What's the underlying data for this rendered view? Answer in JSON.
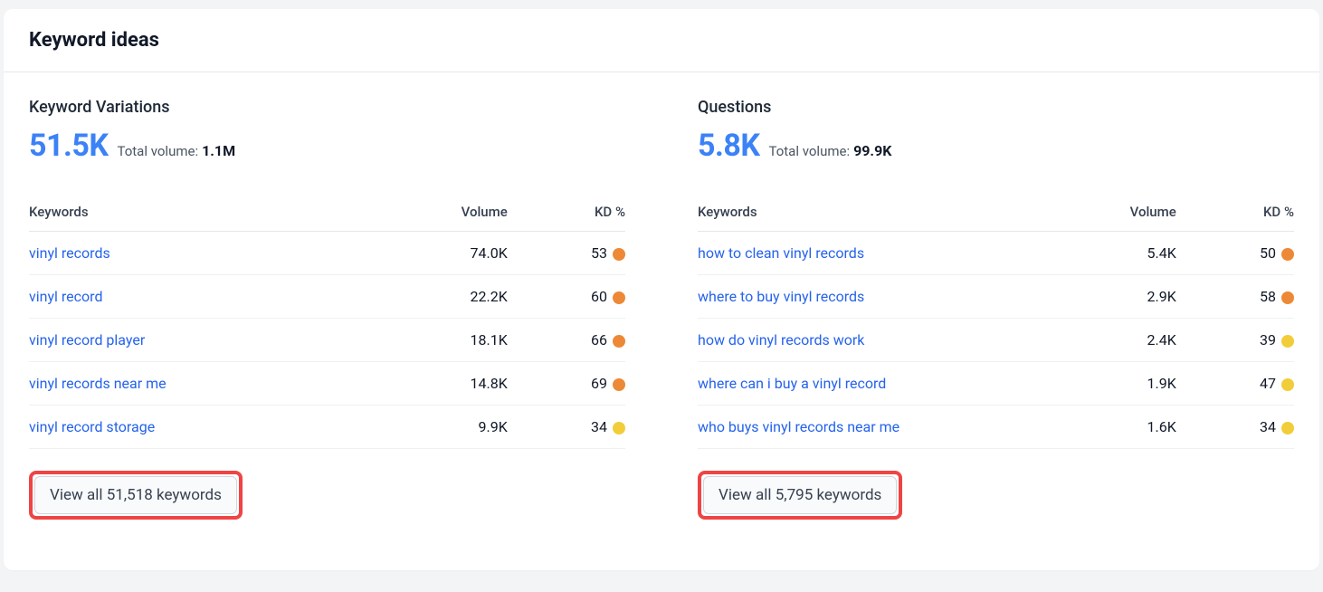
{
  "header": {
    "title": "Keyword ideas"
  },
  "variations": {
    "title": "Keyword Variations",
    "count": "51.5K",
    "total_volume_label": "Total volume:",
    "total_volume": "1.1M",
    "columns": {
      "keywords": "Keywords",
      "volume": "Volume",
      "kd": "KD %"
    },
    "rows": [
      {
        "keyword": "vinyl records",
        "volume": "74.0K",
        "kd": "53",
        "kd_color": "orange"
      },
      {
        "keyword": "vinyl record",
        "volume": "22.2K",
        "kd": "60",
        "kd_color": "orange"
      },
      {
        "keyword": "vinyl record player",
        "volume": "18.1K",
        "kd": "66",
        "kd_color": "orange"
      },
      {
        "keyword": "vinyl records near me",
        "volume": "14.8K",
        "kd": "69",
        "kd_color": "orange"
      },
      {
        "keyword": "vinyl record storage",
        "volume": "9.9K",
        "kd": "34",
        "kd_color": "yellow"
      }
    ],
    "view_all": "View all 51,518 keywords"
  },
  "questions": {
    "title": "Questions",
    "count": "5.8K",
    "total_volume_label": "Total volume:",
    "total_volume": "99.9K",
    "columns": {
      "keywords": "Keywords",
      "volume": "Volume",
      "kd": "KD %"
    },
    "rows": [
      {
        "keyword": "how to clean vinyl records",
        "volume": "5.4K",
        "kd": "50",
        "kd_color": "orange"
      },
      {
        "keyword": "where to buy vinyl records",
        "volume": "2.9K",
        "kd": "58",
        "kd_color": "orange"
      },
      {
        "keyword": "how do vinyl records work",
        "volume": "2.4K",
        "kd": "39",
        "kd_color": "yellow"
      },
      {
        "keyword": "where can i buy a vinyl record",
        "volume": "1.9K",
        "kd": "47",
        "kd_color": "yellow"
      },
      {
        "keyword": "who buys vinyl records near me",
        "volume": "1.6K",
        "kd": "34",
        "kd_color": "yellow"
      }
    ],
    "view_all": "View all 5,795 keywords"
  }
}
